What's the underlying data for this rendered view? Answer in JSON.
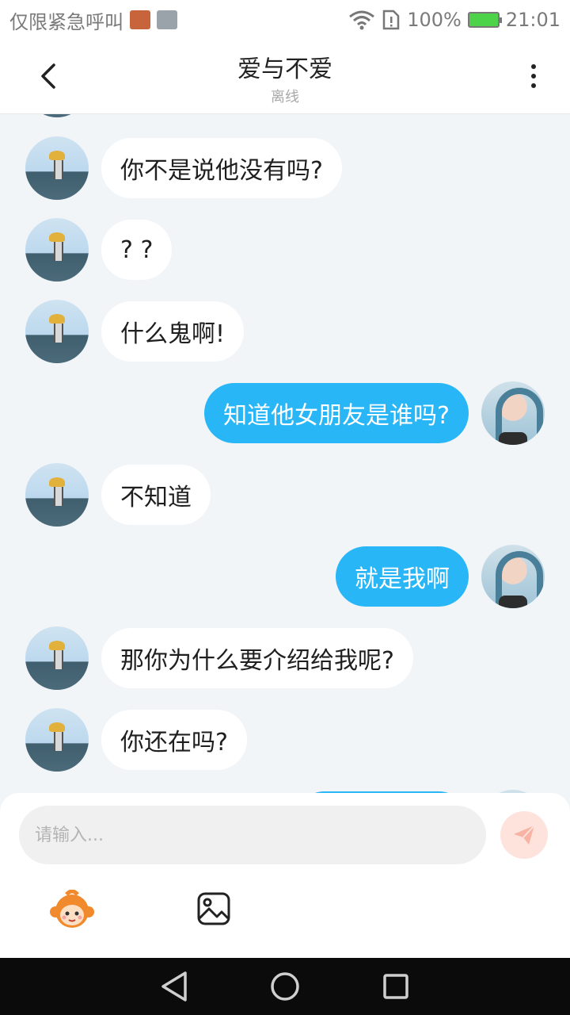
{
  "status_bar": {
    "carrier_text": "仅限紧急呼叫",
    "battery_percent": "100%",
    "time": "21:01"
  },
  "header": {
    "title": "爱与不爱",
    "subtitle": "离线"
  },
  "messages": [
    {
      "side": "other",
      "text": "你不是说他没有吗?"
    },
    {
      "side": "other",
      "text": "? ?"
    },
    {
      "side": "other",
      "text": "什么鬼啊!"
    },
    {
      "side": "self",
      "text": "知道他女朋友是谁吗?"
    },
    {
      "side": "other",
      "text": "不知道"
    },
    {
      "side": "self",
      "text": "就是我啊"
    },
    {
      "side": "other",
      "text": "那你为什么要介绍给我呢?"
    },
    {
      "side": "other",
      "text": "你还在吗?"
    }
  ],
  "composer": {
    "placeholder": "请输入..."
  },
  "colors": {
    "self_bubble": "#29b6f6",
    "other_bubble": "#ffffff",
    "background": "#f2f5f8",
    "send_button": "#fde3dc"
  },
  "icons": {
    "back": "chevron-left-icon",
    "more": "more-vertical-icon",
    "send": "paper-plane-icon",
    "emoji": "monkey-emoji-icon",
    "image": "image-icon"
  }
}
